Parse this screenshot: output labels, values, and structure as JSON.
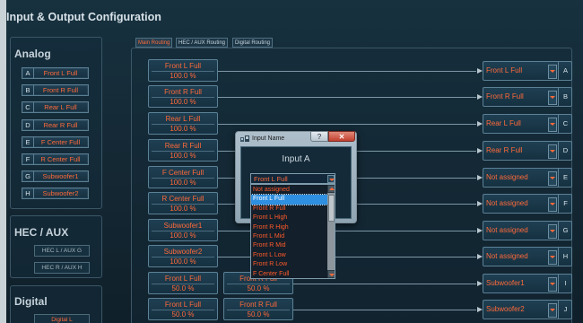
{
  "window": {
    "title": "Input & Output Configuration"
  },
  "analog": {
    "heading": "Analog",
    "inputs": [
      {
        "letter": "A",
        "label": "Front L Full"
      },
      {
        "letter": "B",
        "label": "Front R Full"
      },
      {
        "letter": "C",
        "label": "Rear L Full"
      },
      {
        "letter": "D",
        "label": "Rear R Full"
      },
      {
        "letter": "E",
        "label": "F Center Full"
      },
      {
        "letter": "F",
        "label": "R Center Full"
      },
      {
        "letter": "G",
        "label": "Subwoofer1"
      },
      {
        "letter": "H",
        "label": "Subwoofer2"
      }
    ]
  },
  "hec": {
    "heading": "HEC / AUX",
    "items": [
      "HEC L / AUX G",
      "HEC R / AUX H"
    ]
  },
  "digital": {
    "heading": "Digital",
    "items": [
      "Digital L"
    ]
  },
  "tabs": [
    {
      "label": "Main Routing",
      "active": true
    },
    {
      "label": "HEC / AUX Routing",
      "active": false
    },
    {
      "label": "Digital Routing",
      "active": false
    }
  ],
  "routing": {
    "sources": [
      {
        "name": "Front L Full",
        "value": "100.0 %"
      },
      {
        "name": "Front R Full",
        "value": "100.0 %"
      },
      {
        "name": "Rear L Full",
        "value": "100.0 %"
      },
      {
        "name": "Rear R Full",
        "value": "100.0 %"
      },
      {
        "name": "F Center Full",
        "value": "100.0 %"
      },
      {
        "name": "R Center Full",
        "value": "100.0 %"
      },
      {
        "name": "Subwoofer1",
        "value": "100.0 %"
      },
      {
        "name": "Subwoofer2",
        "value": "100.0 %"
      },
      {
        "name": "Front L Full",
        "value": "50.0 %"
      },
      {
        "name": "Front L Full",
        "value": "50.0 %"
      }
    ],
    "second_sources": [
      {
        "name": "Front R Full",
        "value": "50.0 %"
      },
      {
        "name": "Front R Full",
        "value": "50.0 %"
      }
    ],
    "outputs": [
      {
        "value": "Front L Full",
        "letter": "A"
      },
      {
        "value": "Front R Full",
        "letter": "B"
      },
      {
        "value": "Rear L Full",
        "letter": "C"
      },
      {
        "value": "Rear R Full",
        "letter": "D"
      },
      {
        "value": "Not assigned",
        "letter": "E"
      },
      {
        "value": "Not assigned",
        "letter": "F"
      },
      {
        "value": "Not assigned",
        "letter": "G"
      },
      {
        "value": "Not assigned",
        "letter": "H"
      },
      {
        "value": "Subwoofer1",
        "letter": "I"
      },
      {
        "value": "Subwoofer2",
        "letter": "J"
      }
    ]
  },
  "dialog": {
    "title": "Input Name",
    "help": "?",
    "close": "✕",
    "input_label": "Input A",
    "combo_value": "Front L Full",
    "options": [
      "Not assigned",
      "Front L Full",
      "Front R Full",
      "Front L High",
      "Front R High",
      "Front L Mid",
      "Front R Mid",
      "Front L Low",
      "Front R Low",
      "F Center Full"
    ],
    "selected_index": 1
  },
  "colors": {
    "accent": "#ff6a3a",
    "background": "#152531",
    "selection": "#2f8fe0"
  }
}
